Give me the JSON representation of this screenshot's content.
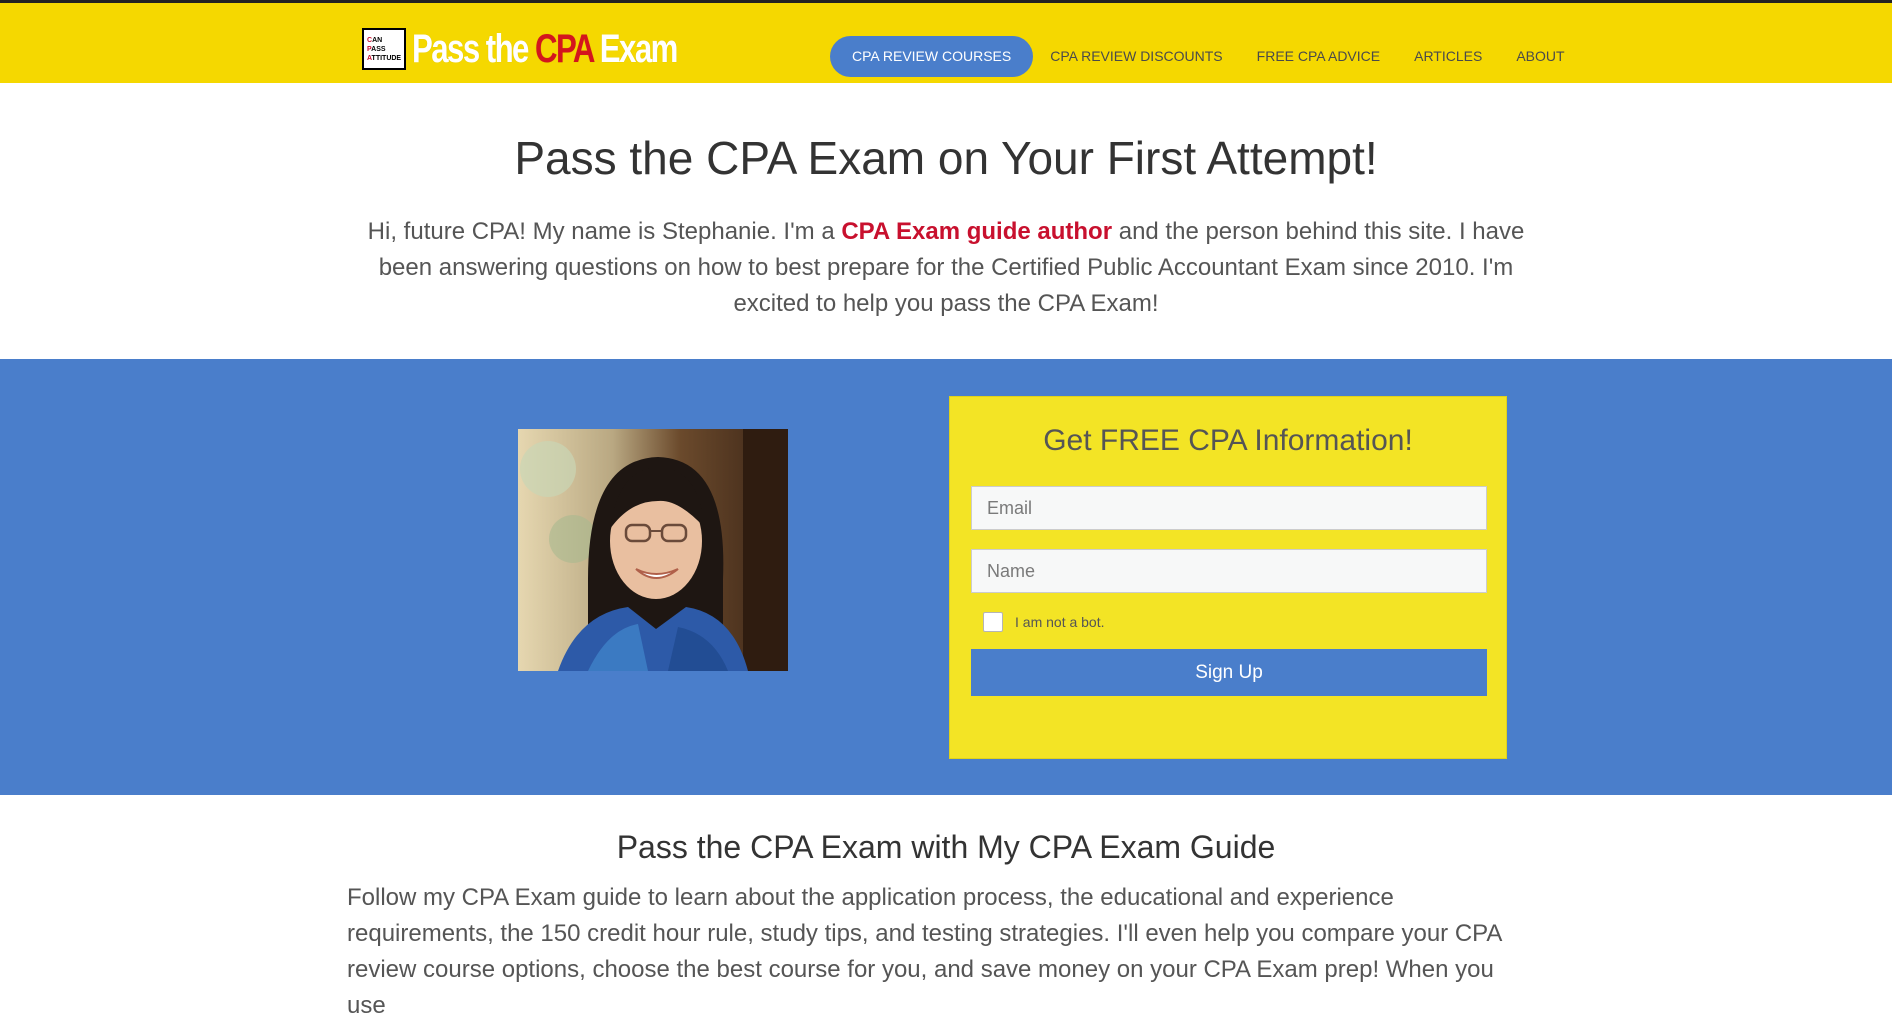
{
  "logo": {
    "box_line1_cap": "C",
    "box_line1_rest": "AN",
    "box_line2_cap": "P",
    "box_line2_rest": "ASS",
    "box_line3_cap": "A",
    "box_line3_rest": "TTITUDE",
    "text_part1": "Pass the ",
    "text_cpa": "CPA",
    "text_part2": " Exam"
  },
  "nav": {
    "items": [
      {
        "label": "CPA REVIEW COURSES",
        "active": true
      },
      {
        "label": "CPA REVIEW DISCOUNTS"
      },
      {
        "label": "FREE CPA ADVICE"
      },
      {
        "label": "ARTICLES"
      },
      {
        "label": "ABOUT"
      }
    ]
  },
  "hero": {
    "title": "Pass the CPA Exam on Your First Attempt!",
    "intro_before": "Hi, future CPA! My name is Stephanie. I'm a ",
    "intro_link": "CPA Exam guide author",
    "intro_after": " and the person behind this site. I have been answering questions on how to best prepare for the Certified Public Accountant Exam since 2010. I'm excited to help you pass the CPA Exam!"
  },
  "signup_form": {
    "title": "Get FREE CPA Information!",
    "email_placeholder": "Email",
    "name_placeholder": "Name",
    "bot_label": "I am not a bot.",
    "button_label": "Sign Up"
  },
  "guide": {
    "title": "Pass the CPA Exam with My CPA Exam Guide",
    "text": "Follow my CPA Exam guide to learn about the application process, the educational and experience requirements, the 150 credit hour rule, study tips, and testing strategies. I'll even help you compare your CPA review course options, choose the best course for you, and save money on your CPA Exam prep! When you use"
  },
  "colors": {
    "header_yellow": "#f5d800",
    "accent_blue": "#4a7ecb",
    "form_yellow": "#f3e425",
    "link_red": "#c8102e"
  }
}
